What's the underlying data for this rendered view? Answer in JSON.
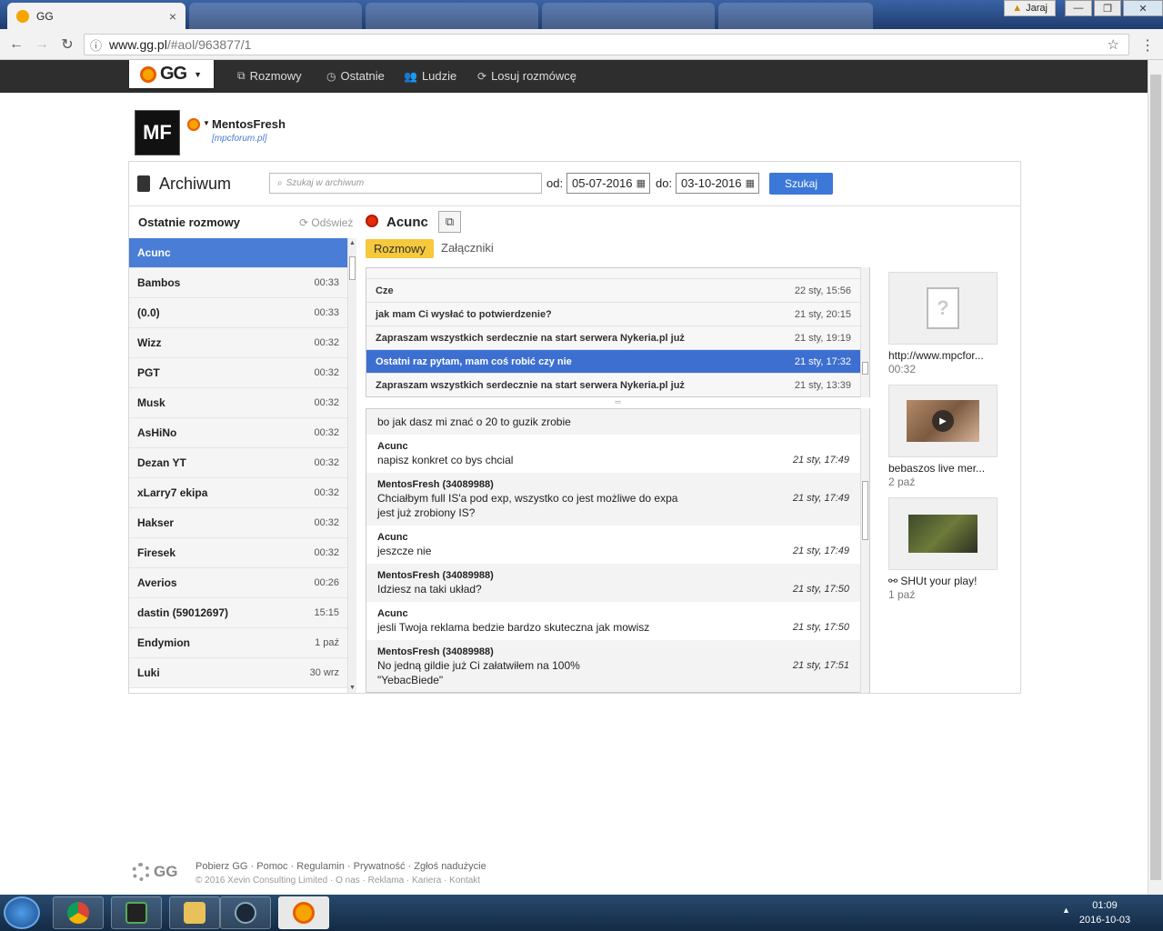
{
  "browser": {
    "active_tab_title": "GG",
    "tab_close": "×",
    "url_host": "www.gg.pl",
    "url_path": "/#aol/963877/1",
    "user_chip": "Jaraj"
  },
  "gg": {
    "logo_text": "GG",
    "nav": [
      {
        "label": "Rozmowy"
      },
      {
        "label": "Ostatnie"
      },
      {
        "label": "Ludzie"
      },
      {
        "label": "Losuj rozmówcę"
      }
    ]
  },
  "profile": {
    "avatar_text": "MF",
    "name": "MentosFresh",
    "description": "[mpcforum.pl]"
  },
  "archive": {
    "title": "Archiwum",
    "search_placeholder": "Szukaj w archiwum",
    "from_label": "od:",
    "from_date": "05-07-2016",
    "to_label": "do:",
    "to_date": "03-10-2016",
    "search_button": "Szukaj"
  },
  "recent": {
    "heading": "Ostatnie rozmowy",
    "refresh_label": "Odśwież",
    "items": [
      {
        "name": "Acunc",
        "time": ""
      },
      {
        "name": "Bambos",
        "time": "00:33"
      },
      {
        "name": "(0.0)",
        "time": "00:33"
      },
      {
        "name": "Wizz",
        "time": "00:32"
      },
      {
        "name": "PGT",
        "time": "00:32"
      },
      {
        "name": "Musk",
        "time": "00:32"
      },
      {
        "name": "AsHiNo",
        "time": "00:32"
      },
      {
        "name": "Dezan YT",
        "time": "00:32"
      },
      {
        "name": "xLarry7 ekipa",
        "time": "00:32"
      },
      {
        "name": "Hakser",
        "time": "00:32"
      },
      {
        "name": "Firesek",
        "time": "00:32"
      },
      {
        "name": "Averios",
        "time": "00:26"
      },
      {
        "name": "dastin (59012697)",
        "time": "15:15"
      },
      {
        "name": "Endymion",
        "time": "1 paź"
      },
      {
        "name": "Luki",
        "time": "30 wrz"
      }
    ]
  },
  "chat": {
    "contact": "Acunc",
    "tab_conversations": "Rozmowy",
    "tab_attachments": "Załączniki",
    "threads": [
      {
        "text": "Cze",
        "date": "22 sty, 15:56"
      },
      {
        "text": "jak mam Ci wysłać to potwierdzenie?",
        "date": "21 sty, 20:15"
      },
      {
        "text": "Zapraszam wszystkich serdecznie na start serwera Nykeria.pl już",
        "date": "21 sty, 19:19"
      },
      {
        "text": "Ostatni raz pytam, mam coś robić czy nie",
        "date": "21 sty, 17:32"
      },
      {
        "text": "Zapraszam wszystkich serdecznie na start serwera Nykeria.pl już",
        "date": "21 sty, 13:39"
      }
    ],
    "messages": [
      {
        "author": "",
        "lines": [
          "bo jak dasz mi znać o 20 to guzik zrobie"
        ],
        "time": ""
      },
      {
        "author": "Acunc",
        "lines": [
          "napisz konkret co bys chcial"
        ],
        "time": "21 sty, 17:49"
      },
      {
        "author": "MentosFresh (34089988)",
        "lines": [
          "Chciałbym full IS'a pod exp, wszystko co jest możliwe do expa",
          "jest już zrobiony IS?"
        ],
        "time": "21 sty, 17:49"
      },
      {
        "author": "Acunc",
        "lines": [
          "jeszcze nie"
        ],
        "time": "21 sty, 17:49"
      },
      {
        "author": "MentosFresh (34089988)",
        "lines": [
          "Idziesz na taki układ?"
        ],
        "time": "21 sty, 17:50"
      },
      {
        "author": "Acunc",
        "lines": [
          "jesli Twoja reklama bedzie bardzo skuteczna jak mowisz"
        ],
        "time": "21 sty, 17:50"
      },
      {
        "author": "MentosFresh (34089988)",
        "lines": [
          "No jedną gildie już Ci załatwiłem na 100%",
          "\"YebacBiede\""
        ],
        "time": "21 sty, 17:51"
      }
    ]
  },
  "attachments": [
    {
      "name": "http://www.mpcfor...",
      "sub": "00:32",
      "icon": "document-icon"
    },
    {
      "name": "bebaszos live mer...",
      "sub": "2 paź",
      "icon": "video-thumbnail"
    },
    {
      "name": "⚯ SHUt your play!",
      "sub": "1 paź",
      "icon": "image-thumbnail"
    }
  ],
  "footer": {
    "logo": "GG",
    "links": "Pobierz GG · Pomoc · Regulamin · Prywatność · Zgłoś nadużycie",
    "copyright": "© 2016 Xevin Consulting Limited · O nas · Reklama · Kariera · Kontakt"
  },
  "taskbar": {
    "time": "01:09",
    "date": "2016-10-03"
  }
}
